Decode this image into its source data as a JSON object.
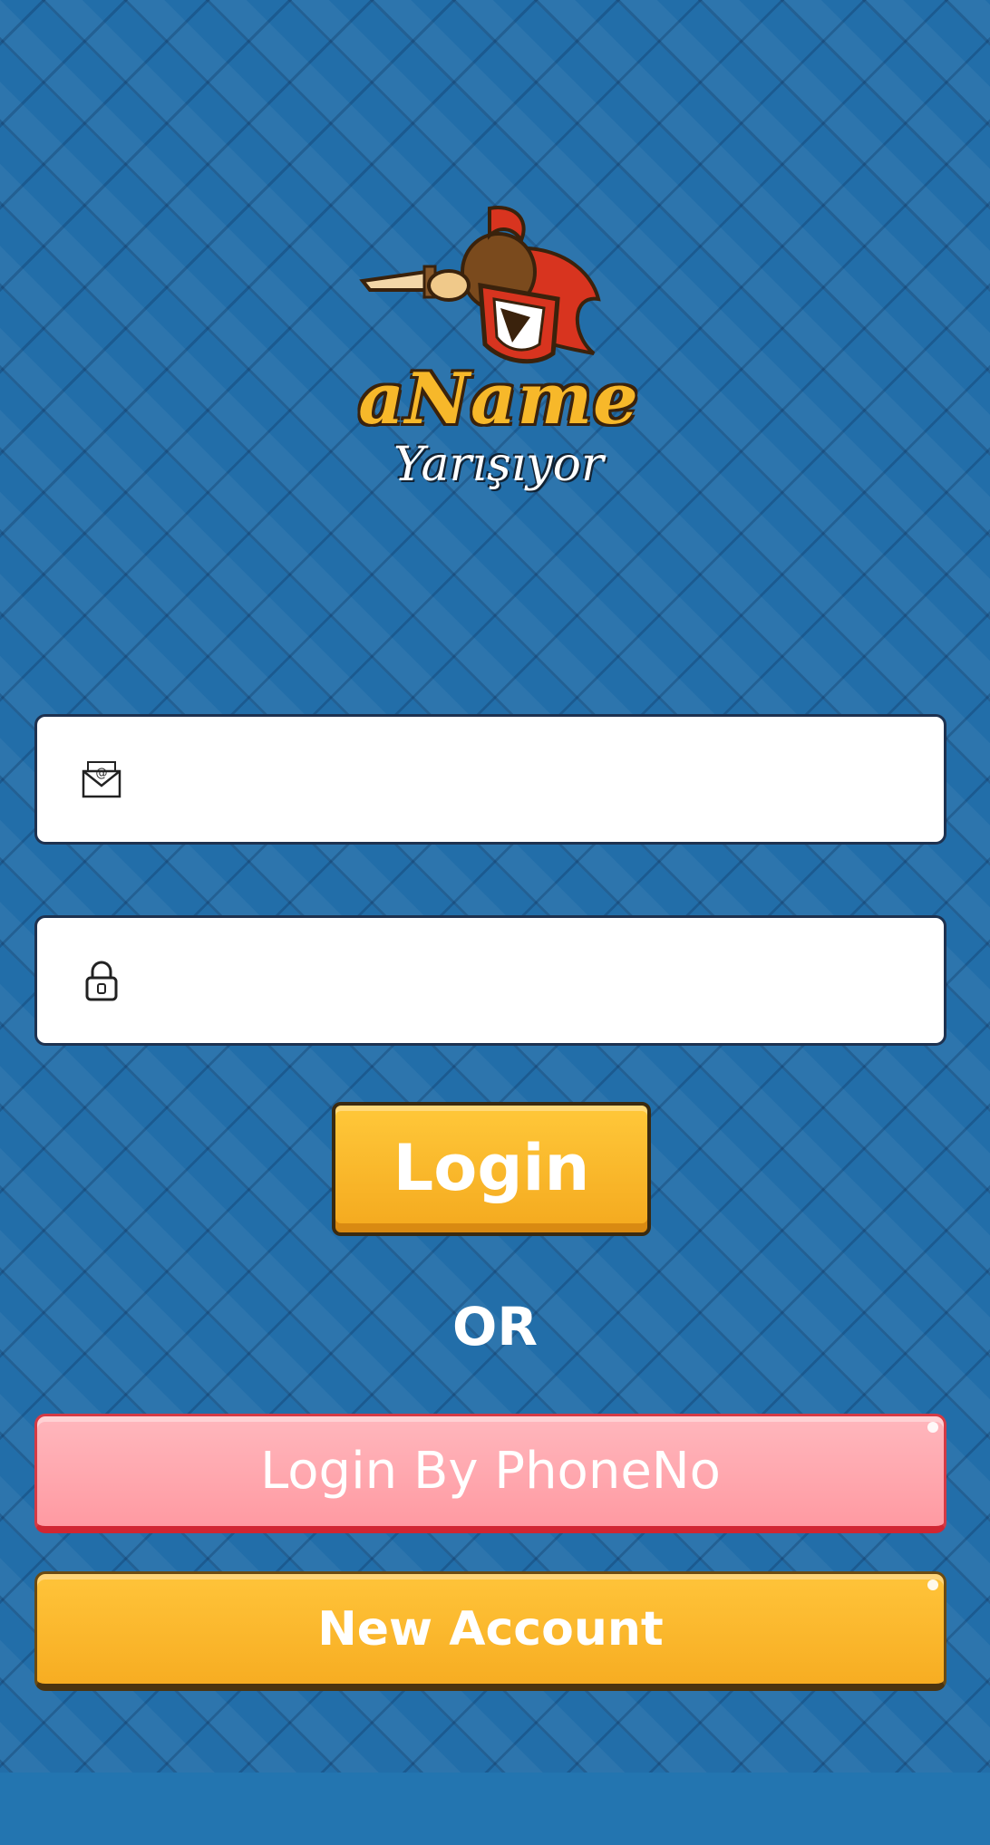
{
  "logo": {
    "title": "aName",
    "subtitle": "Yarışıyor",
    "mascot_icon": "knight-mascot-icon"
  },
  "form": {
    "email": {
      "icon": "envelope-icon",
      "value": ""
    },
    "password": {
      "icon": "lock-icon",
      "value": ""
    }
  },
  "buttons": {
    "login_label": "Login",
    "or_label": "OR",
    "phone_label": "Login By PhoneNo",
    "new_account_label": "New Account"
  },
  "colors": {
    "background": "#226ea9",
    "primary_yellow": "#f7ad22",
    "phone_pink": "#ff9aa2",
    "logo_gold": "#f7b82a"
  }
}
